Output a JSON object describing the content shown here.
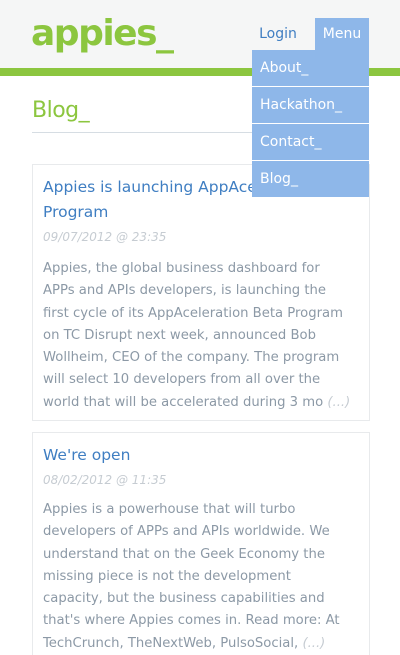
{
  "header": {
    "logo": "appies_",
    "login_label": "Login",
    "menu_label": "Menu"
  },
  "menu": {
    "items": [
      {
        "label": "About_"
      },
      {
        "label": "Hackathon_"
      },
      {
        "label": "Contact_"
      },
      {
        "label": "Blog_"
      }
    ]
  },
  "section": {
    "title": "Blog_"
  },
  "posts": [
    {
      "title_line1": "Appies is launching AppAceleration Beta",
      "title_line2": "Program",
      "date": "09/07/2012 @ 23:35",
      "excerpt_lines": [
        "Appies, the global business dashboard for",
        "APPs and APIs developers, is launching the",
        "first cycle of its AppAceleration Beta Program",
        "on TC Disrupt next week, announced Bob",
        "Wollheim, CEO of the company. The program",
        "will select 10 developers from all over the",
        "world that will be accelerated during 3 mo"
      ],
      "more": "(...)"
    },
    {
      "title_line1": "We're open",
      "date": "08/02/2012 @ 11:35",
      "excerpt_lines": [
        "Appies is a powerhouse that will turbo",
        "developers of APPs and APIs worldwide. We",
        "understand that on the Geek Economy the",
        "missing piece is not the development",
        "capacity, but the business capabilities and",
        "that's where Appies comes in. Read more: At",
        "TechCrunch, TheNextWeb, PulsoSocial,"
      ],
      "more": "(...)"
    }
  ],
  "colors": {
    "brand_green": "#8cc63f",
    "menu_blue": "#8eb7e9",
    "link_blue": "#3f7ec2"
  }
}
